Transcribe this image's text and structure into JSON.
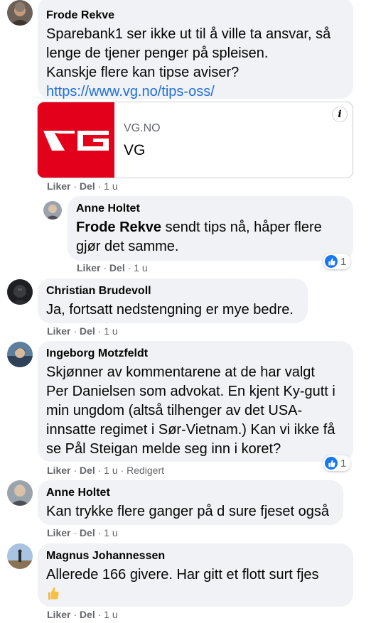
{
  "comments": [
    {
      "author": "Frode Rekve",
      "lines": [
        "Sparebank1 ser ikke ut til å ville ta ansvar, så",
        "lenge de tjener penger på spleisen.",
        "Kanskje flere kan tipse aviser?"
      ],
      "link": "https://www.vg.no/tips-oss/",
      "card": {
        "domain": "VG.NO",
        "title": "VG",
        "logo_text": "VG"
      },
      "actions": {
        "like": "Liker",
        "reply": "Del",
        "time": "1 u"
      }
    },
    {
      "author": "Anne Holtet",
      "mention": "Frode Rekve",
      "line1_rest": " sendt tips nå, håper flere",
      "line2": "gjør det samme.",
      "reaction_count": "1",
      "actions": {
        "like": "Liker",
        "reply": "Del",
        "time": "1 u"
      }
    },
    {
      "author": "Christian Brudevoll",
      "lines": [
        "Ja, fortsatt nedstengning er mye bedre."
      ],
      "actions": {
        "like": "Liker",
        "reply": "Del",
        "time": "1 u"
      }
    },
    {
      "author": "Ingeborg Motzfeldt",
      "lines": [
        "Skjønner av kommentarene at de har valgt",
        "Per Danielsen som advokat. En kjent Ky-gutt i",
        "min ungdom (altså tilhenger av det USA-",
        "innsatte regimet i Sør-Vietnam.) Kan vi ikke få",
        "se Pål Steigan melde seg inn i koret?"
      ],
      "reaction_count": "1",
      "actions": {
        "like": "Liker",
        "reply": "Del",
        "time": "1 u",
        "edited": "Redigert"
      }
    },
    {
      "author": "Anne Holtet",
      "lines": [
        "Kan trykke flere ganger på d sure fjeset også"
      ],
      "actions": {
        "like": "Liker",
        "reply": "Del",
        "time": "1 u"
      }
    },
    {
      "author": "Magnus Johannessen",
      "lines": [
        "Allerede 166 givere. Har gitt et flott surt fjes"
      ],
      "emoji": "👍",
      "actions": {
        "like": "Liker",
        "reply": "Del",
        "time": "1 u"
      }
    }
  ],
  "colors": {
    "bubble": "#f0f2f5",
    "link": "#216fdb",
    "meta": "#65676b",
    "like_blue": "#1877f2",
    "vg_red": "#e3001b"
  },
  "icons": {
    "info": "info-icon",
    "like": "like-reaction-icon",
    "thumbs_up": "thumbs-up-emoji"
  }
}
